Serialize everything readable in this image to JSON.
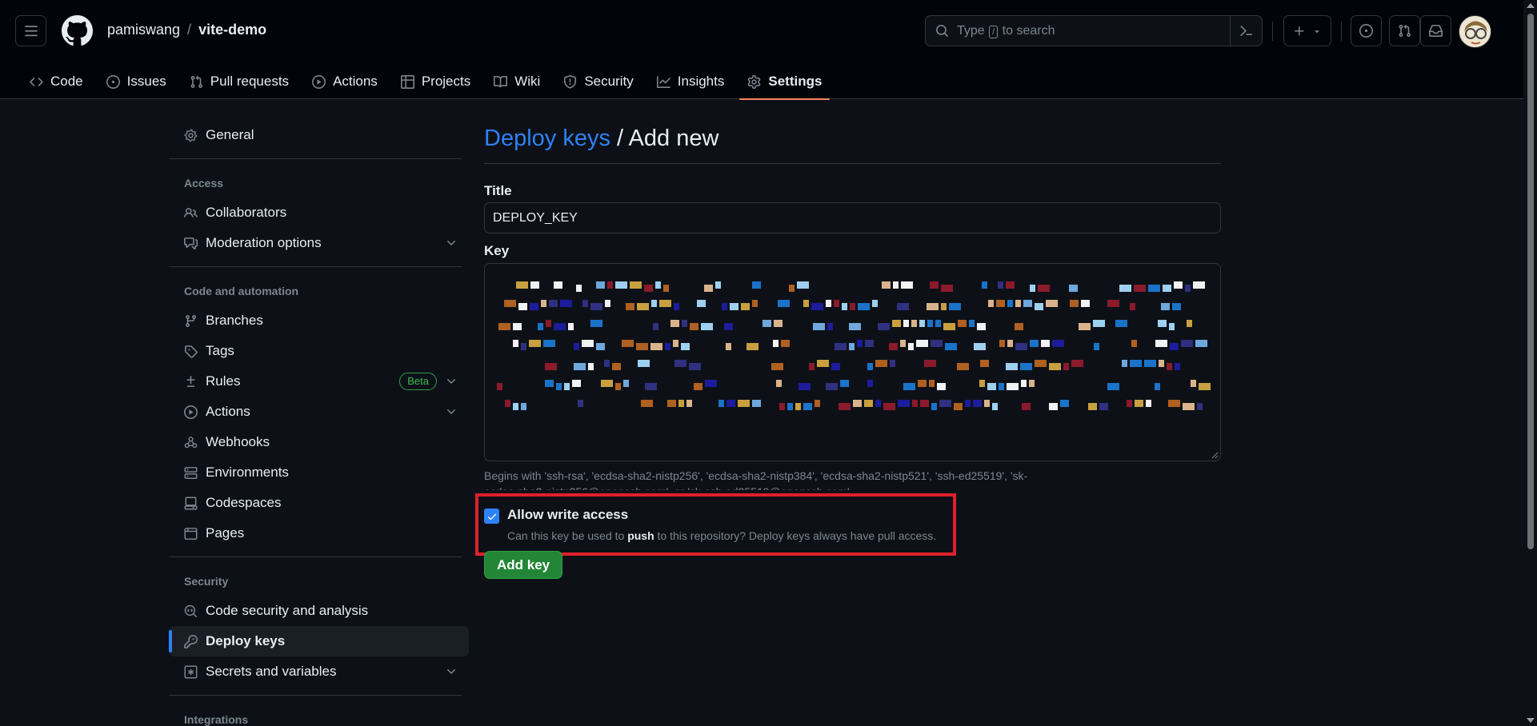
{
  "header": {
    "owner": "pamiswang",
    "separator": "/",
    "repo": "vite-demo",
    "search_placeholder_before": "Type",
    "search_key": "/",
    "search_placeholder_after": "to search"
  },
  "tabs": [
    {
      "label": "Code",
      "icon": "code-icon"
    },
    {
      "label": "Issues",
      "icon": "issue-icon"
    },
    {
      "label": "Pull requests",
      "icon": "pull-request-icon"
    },
    {
      "label": "Actions",
      "icon": "play-icon"
    },
    {
      "label": "Projects",
      "icon": "table-icon"
    },
    {
      "label": "Wiki",
      "icon": "book-icon"
    },
    {
      "label": "Security",
      "icon": "shield-icon"
    },
    {
      "label": "Insights",
      "icon": "graph-icon"
    },
    {
      "label": "Settings",
      "icon": "gear-icon",
      "active": true
    }
  ],
  "sidebar": {
    "general": "General",
    "access_heading": "Access",
    "collaborators": "Collaborators",
    "moderation": "Moderation options",
    "code_heading": "Code and automation",
    "branches": "Branches",
    "tags": "Tags",
    "rules": "Rules",
    "rules_badge": "Beta",
    "actions": "Actions",
    "webhooks": "Webhooks",
    "environments": "Environments",
    "codespaces": "Codespaces",
    "pages": "Pages",
    "security_heading": "Security",
    "code_security": "Code security and analysis",
    "deploy_keys": "Deploy keys",
    "secrets": "Secrets and variables",
    "integrations_heading": "Integrations"
  },
  "main": {
    "title_link": "Deploy keys",
    "title_rest": "/ Add new",
    "title_label": "Title",
    "title_value": "DEPLOY_KEY",
    "key_label": "Key",
    "key_hint": "Begins with 'ssh-rsa', 'ecdsa-sha2-nistp256', 'ecdsa-sha2-nistp384', 'ecdsa-sha2-nistp521', 'ssh-ed25519', 'sk-ecdsa-sha2-nistp256@openssh.com', or 'sk-ssh-ed25519@openssh.com'",
    "write_access_label": "Allow write access",
    "write_access_checked": true,
    "write_desc_before": "Can this key be used to",
    "write_desc_bold": "push",
    "write_desc_after": "to this repository? Deploy keys always have pull access.",
    "add_button": "Add key"
  },
  "colors": {
    "background": "#0d1117",
    "header_bg": "#010409",
    "accent_blue": "#2f81f7",
    "active_tab_underline": "#f78166",
    "primary_button": "#238636",
    "highlight_box": "#e0202c"
  }
}
